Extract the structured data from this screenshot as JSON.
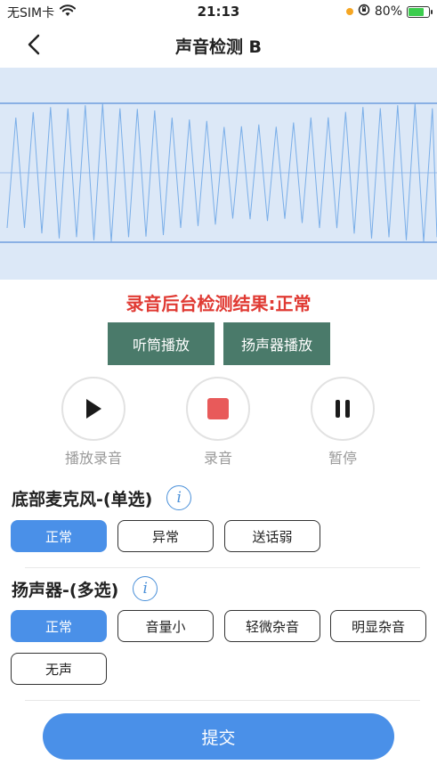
{
  "status_bar": {
    "carrier": "无SIM卡",
    "time": "21:13",
    "battery_percent": "80%",
    "battery_level": 0.8,
    "colors": {
      "orange_dot": "#f5a623",
      "battery_fill": "#3ccd4e"
    }
  },
  "nav": {
    "title": "声音检测 B",
    "back_icon": "chevron-left-icon"
  },
  "result": {
    "text": "录音后台检测结果:正常",
    "color": "#e03a33"
  },
  "playback": {
    "earpiece_label": "听筒播放",
    "speaker_label": "扬声器播放",
    "color": "#4a7a6a"
  },
  "controls": {
    "play_label": "播放录音",
    "record_label": "录音",
    "pause_label": "暂停",
    "record_color": "#e85a5a"
  },
  "microphone": {
    "title": "底部麦克风-(单选)",
    "options": [
      {
        "label": "正常",
        "selected": true
      },
      {
        "label": "异常",
        "selected": false
      },
      {
        "label": "送话弱",
        "selected": false
      }
    ]
  },
  "speaker": {
    "title": "扬声器-(多选)",
    "options": [
      {
        "label": "正常",
        "selected": true
      },
      {
        "label": "音量小",
        "selected": false
      },
      {
        "label": "轻微杂音",
        "selected": false
      },
      {
        "label": "明显杂音",
        "selected": false
      },
      {
        "label": "无声",
        "selected": false
      }
    ]
  },
  "submit": {
    "label": "提交",
    "color": "#4a90e8"
  }
}
